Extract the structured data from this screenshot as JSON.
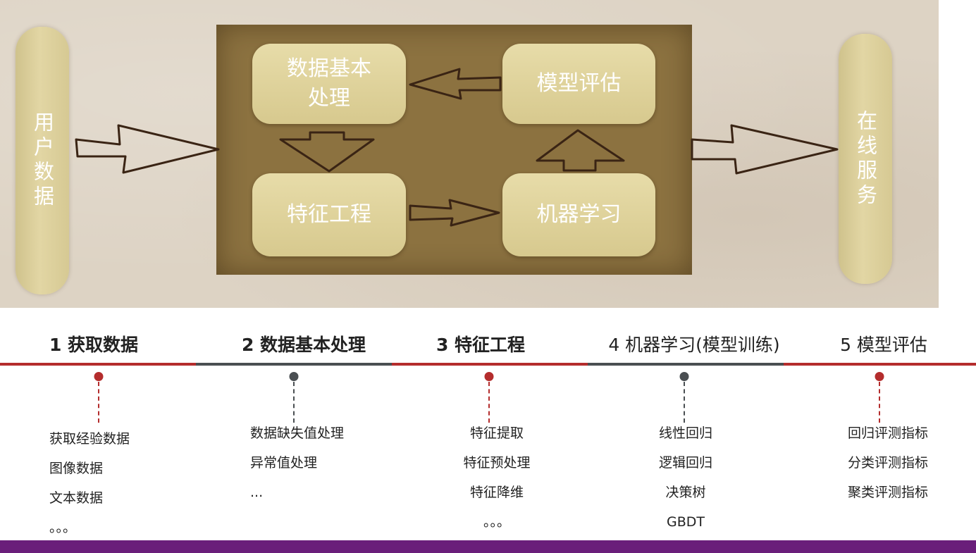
{
  "diagram": {
    "left_pill": "用户数据",
    "right_pill": "在线服务",
    "boxes": {
      "data_processing": [
        "数据基本",
        "处理"
      ],
      "model_eval": "模型评估",
      "feature_eng": "特征工程",
      "ml": "机器学习"
    }
  },
  "timeline": {
    "colors": {
      "red": "#b42d2d",
      "gray": "#4a4f52"
    },
    "steps": [
      {
        "title": "1 获取数据",
        "items": [
          "获取经验数据",
          "图像数据",
          "文本数据",
          "。。。"
        ]
      },
      {
        "title": "2 数据基本处理",
        "items": [
          "数据缺失值处理",
          "异常值处理",
          "..."
        ]
      },
      {
        "title": "3 特征工程",
        "items": [
          "特征提取",
          "特征预处理",
          "特征降维",
          "。。。"
        ]
      },
      {
        "title": "4 机器学习(模型训练)",
        "items": [
          "线性回归",
          "逻辑回归",
          "决策树",
          "GBDT"
        ]
      },
      {
        "title": "5 模型评估",
        "items": [
          "回归评测指标",
          "分类评测指标",
          "聚类评测指标"
        ]
      }
    ]
  },
  "bottom_bar_color": "#6a1e7a"
}
